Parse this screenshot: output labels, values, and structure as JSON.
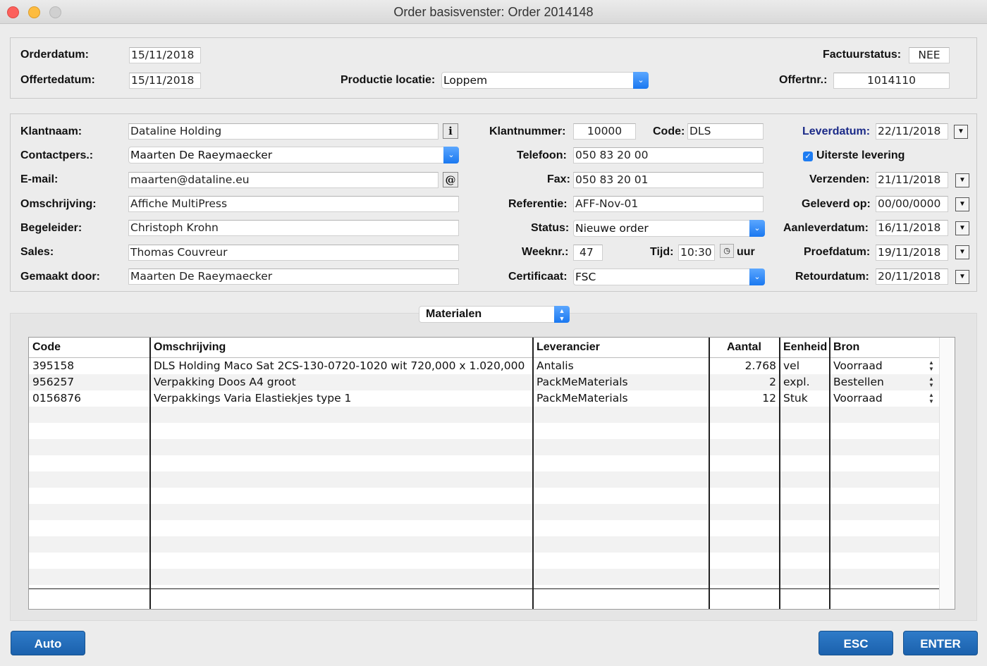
{
  "window": {
    "title": "Order basisvenster: Order 2014148"
  },
  "top": {
    "orderdatum_label": "Orderdatum:",
    "orderdatum": "15/11/2018",
    "offertedatum_label": "Offertedatum:",
    "offertedatum": "15/11/2018",
    "productie_locatie_label": "Productie locatie:",
    "productie_locatie": "Loppem",
    "factuurstatus_label": "Factuurstatus:",
    "factuurstatus": "NEE",
    "offertnr_label": "Offertnr.:",
    "offertnr": "1014110"
  },
  "client": {
    "klantnaam_label": "Klantnaam:",
    "klantnaam": "Dataline Holding",
    "contactpers_label": "Contactpers.:",
    "contactpers": "Maarten De Raeymaecker",
    "email_label": "E-mail:",
    "email": "maarten@dataline.eu",
    "omschrijving_label": "Omschrijving:",
    "omschrijving": "Affiche MultiPress",
    "begeleider_label": "Begeleider:",
    "begeleider": "Christoph Krohn",
    "sales_label": "Sales:",
    "sales": "Thomas Couvreur",
    "gemaakt_door_label": "Gemaakt door:",
    "gemaakt_door": "Maarten De Raeymaecker",
    "info_icon": "i",
    "email_icon": "@"
  },
  "order": {
    "klantnummer_label": "Klantnummer:",
    "klantnummer": "10000",
    "code_label": "Code:",
    "code": "DLS",
    "telefoon_label": "Telefoon:",
    "telefoon": "050 83 20 00",
    "fax_label": "Fax:",
    "fax": "050 83 20 01",
    "referentie_label": "Referentie:",
    "referentie": "AFF-Nov-01",
    "status_label": "Status:",
    "status": "Nieuwe order",
    "weeknr_label": "Weeknr.:",
    "weeknr": "47",
    "tijd_label": "Tijd:",
    "tijd": "10:30",
    "uur_label": "uur",
    "certificaat_label": "Certificaat:",
    "certificaat": "FSC"
  },
  "dates": {
    "leverdatum_label": "Leverdatum:",
    "leverdatum": "22/11/2018",
    "uiterste_levering_label": "Uiterste levering",
    "uiterste_levering_checked": true,
    "verzenden_label": "Verzenden:",
    "verzenden": "21/11/2018",
    "geleverd_op_label": "Geleverd op:",
    "geleverd_op": "00/00/0000",
    "aanleverdatum_label": "Aanleverdatum:",
    "aanleverdatum": "16/11/2018",
    "proefdatum_label": "Proefdatum:",
    "proefdatum": "19/11/2018",
    "retourdatum_label": "Retourdatum:",
    "retourdatum": "20/11/2018"
  },
  "materials": {
    "selector": "Materialen",
    "columns": [
      "Code",
      "Omschrijving",
      "Leverancier",
      "Aantal",
      "Eenheid",
      "Bron"
    ],
    "rows": [
      {
        "code": "395158",
        "omschrijving": "DLS Holding Maco Sat 2CS-130-0720-1020 wit 720,000 x 1.020,000",
        "leverancier": "Antalis",
        "aantal": "2.768",
        "eenheid": "vel",
        "bron": "Voorraad"
      },
      {
        "code": "956257",
        "omschrijving": "Verpakking Doos A4 groot",
        "leverancier": "PackMeMaterials",
        "aantal": "2",
        "eenheid": "expl.",
        "bron": "Bestellen"
      },
      {
        "code": "0156876",
        "omschrijving": "Verpakkings Varia Elastiekjes type 1",
        "leverancier": "PackMeMaterials",
        "aantal": "12",
        "eenheid": "Stuk",
        "bron": "Voorraad"
      }
    ]
  },
  "buttons": {
    "auto": "Auto",
    "esc": "ESC",
    "enter": "ENTER"
  },
  "colors": {
    "accent_blue": "#1b61ad",
    "popup_blue": "#1a78f0",
    "label_blue": "#1b2a88"
  }
}
